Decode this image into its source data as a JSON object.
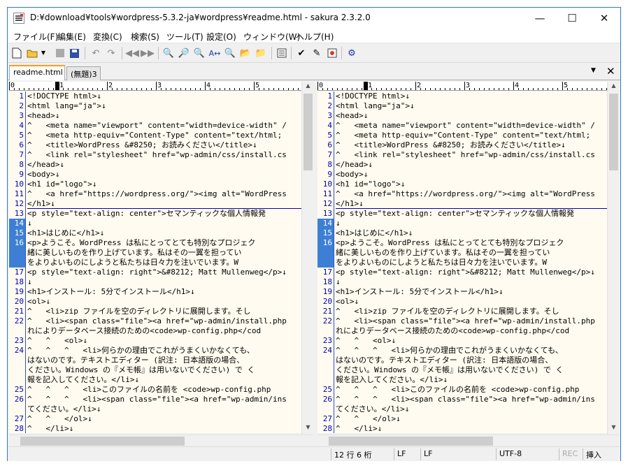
{
  "window": {
    "title": "D:¥download¥tools¥wordpress-5.3.2-ja¥wordpress¥readme.html - sakura 2.3.2.0"
  },
  "window_controls": {
    "minimize": "—",
    "maximize": "☐",
    "close": "✕"
  },
  "menubar": {
    "items": [
      "ファイル(F)",
      "編集(E)",
      "変換(C)",
      "検索(S)",
      "ツール(T)",
      "設定(O)",
      "ウィンドウ(W)",
      "ヘルプ(H)"
    ]
  },
  "toolbar": {
    "icons": [
      "new-file-icon",
      "open-folder-icon",
      "dropdown-arrow-icon",
      "save-disabled-icon",
      "save-all-icon",
      "undo-icon",
      "redo-icon",
      "prev-icon",
      "next-icon",
      "find-icon",
      "find-next-icon",
      "find-prev-icon",
      "replace-icon",
      "mark-icon",
      "grep-icon",
      "grep-replace-icon",
      "outline-icon",
      "compare-icon",
      "diff-icon",
      "macro-icon",
      "settings-icon"
    ]
  },
  "tabs": [
    {
      "label": "readme.html",
      "active": true
    },
    {
      "label": "(無題)3",
      "active": false
    }
  ],
  "tab_controls": {
    "menu": "▼",
    "close": "✕"
  },
  "ruler": {
    "labels": [
      "0",
      "1",
      "2",
      "3",
      "4",
      "5"
    ]
  },
  "editor": {
    "rows": [
      {
        "ln": "1",
        "text": "<!DOCTYPE html>↓"
      },
      {
        "ln": "2",
        "text": "<html lang=\"ja\">↓"
      },
      {
        "ln": "3",
        "text": "<head>↓"
      },
      {
        "ln": "4",
        "text": "^   <meta name=\"viewport\" content=\"width=device-width\" /"
      },
      {
        "ln": "5",
        "text": "^   <meta http-equiv=\"Content-Type\" content=\"text/html;"
      },
      {
        "ln": "6",
        "text": "^   <title>WordPress &#8250; お読みください</title>↓"
      },
      {
        "ln": "7",
        "text": "^   <link rel=\"stylesheet\" href=\"wp-admin/css/install.cs"
      },
      {
        "ln": "8",
        "text": "</head>↓"
      },
      {
        "ln": "9",
        "text": "<body>↓"
      },
      {
        "ln": "10",
        "text": "<h1 id=\"logo\">↓"
      },
      {
        "ln": "11",
        "text": "^   <a href=\"https://wordpress.org/\"><img alt=\"WordPress"
      },
      {
        "ln": "12",
        "text": "</h1>↓"
      },
      {
        "ln": "13",
        "text": "<p style=\"text-align: center\">セマンティックな個人情報発"
      },
      {
        "ln": "14",
        "text": "↓"
      },
      {
        "ln": "15",
        "text": "<h1>はじめに</h1>↓"
      },
      {
        "ln": "16",
        "text": "<p>ようこそ。WordPress は私にとってとても特別なプロジェク"
      },
      {
        "ln": "",
        "text": "緒に美しいものを作り上げています。私はその一翼を担ってい"
      },
      {
        "ln": "",
        "text": "をよりよいものにしようと私たちは日々力を注いでいます。W"
      },
      {
        "ln": "17",
        "text": "<p style=\"text-align: right\">&#8212; Matt Mullenweg</p>↓"
      },
      {
        "ln": "18",
        "text": "↓"
      },
      {
        "ln": "19",
        "text": "<h1>インストール: 5分でインストール</h1>↓"
      },
      {
        "ln": "20",
        "text": "<ol>↓"
      },
      {
        "ln": "21",
        "text": "^   <li>zip ファイルを空のディレクトリに展開します。そし"
      },
      {
        "ln": "22",
        "text": "^   <li><span class=\"file\"><a href=\"wp-admin/install.php"
      },
      {
        "ln": "",
        "text": "れによりデータベース接続のための<code>wp-config.php</cod"
      },
      {
        "ln": "23",
        "text": "^   ^   <ol>↓"
      },
      {
        "ln": "24",
        "text": "^   ^   ^   <li>何らかの理由でこれがうまくいかなくても、"
      },
      {
        "ln": "",
        "text": "はないのです。テキストエディター (訳注: 日本語版の場合、"
      },
      {
        "ln": "",
        "text": "ください。Windows の『メモ帳』は用いないでください) で く"
      },
      {
        "ln": "",
        "text": "報を記入してください。</li>↓"
      },
      {
        "ln": "25",
        "text": "^   ^   ^   <li>このファイルの名前を <code>wp-config.php"
      },
      {
        "ln": "26",
        "text": "^   ^   ^   <li><span class=\"file\"><a href=\"wp-admin/ins"
      },
      {
        "ln": "",
        "text": "てください。</li>↓"
      },
      {
        "ln": "27",
        "text": "^   ^   </ol>↓"
      },
      {
        "ln": "28",
        "text": "^   </li>↓"
      }
    ]
  },
  "status": {
    "position": "12 行   6 桁",
    "eol1": "LF",
    "eol2": "LF",
    "encoding": "UTF-8",
    "rec": "REC",
    "mode": "挿入"
  }
}
